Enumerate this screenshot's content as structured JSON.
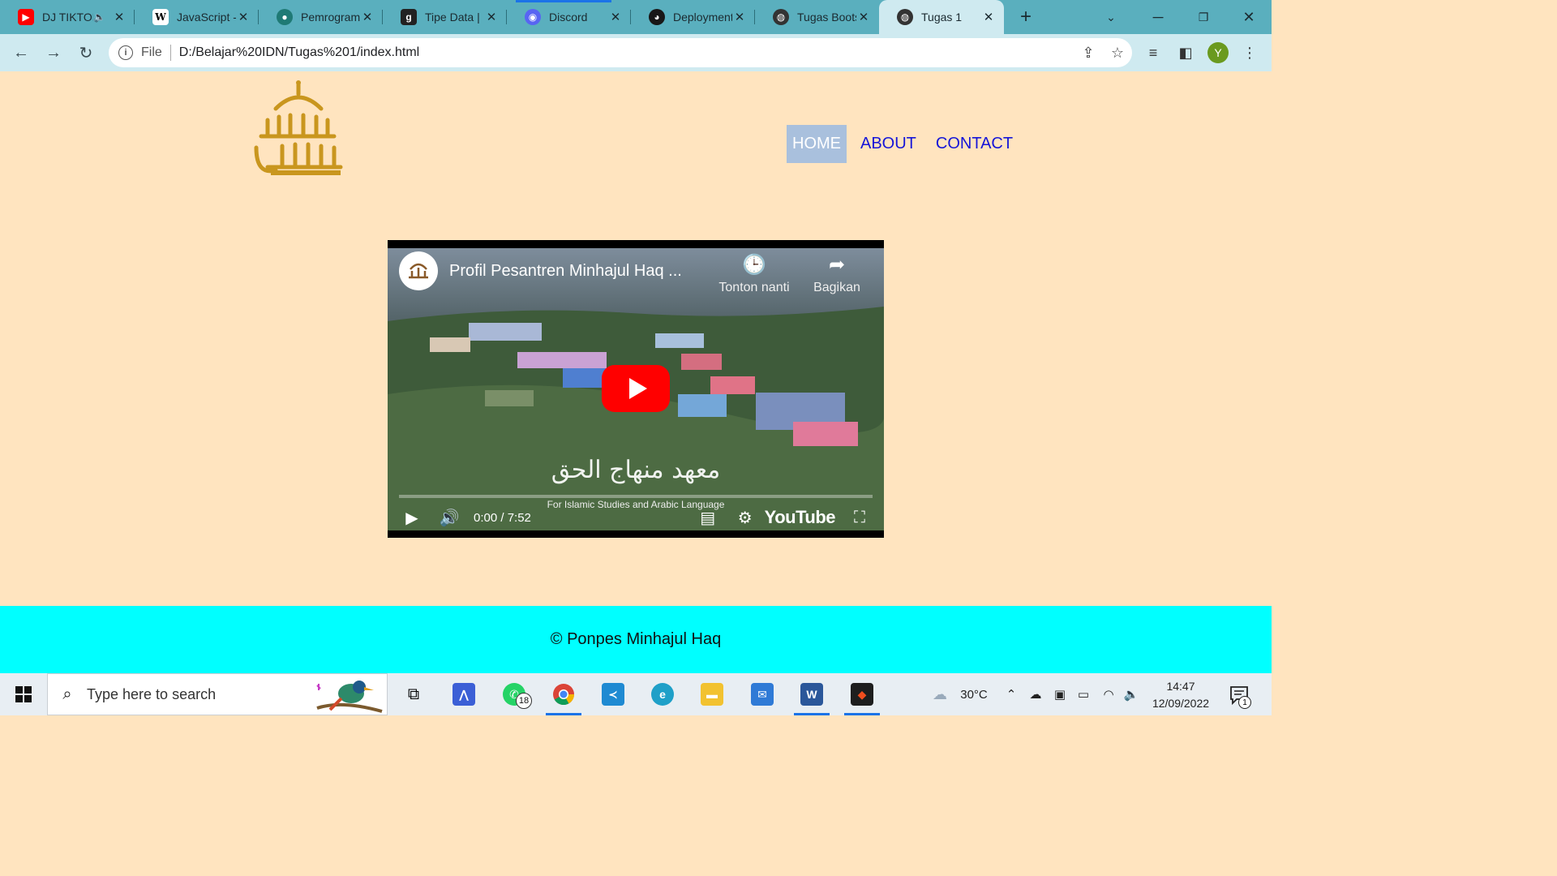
{
  "browser": {
    "tabs": [
      {
        "title": "DJ TIKTOK",
        "icon": "youtube-icon",
        "muted_icon": "speaker-icon",
        "color": "#ff0000"
      },
      {
        "title": "JavaScript - Wikipedia",
        "icon": "wikipedia-icon",
        "color": "#ffffff"
      },
      {
        "title": "Pemrograman",
        "icon": "site-icon",
        "color": "#1f7a75"
      },
      {
        "title": "Tipe Data | ",
        "icon": "site-icon",
        "color": "#222222"
      },
      {
        "title": "Discord",
        "icon": "discord-icon",
        "color": "#5865f2"
      },
      {
        "title": "Deployment",
        "icon": "github-icon",
        "color": "#181717"
      },
      {
        "title": "Tugas Bootstrap",
        "icon": "globe-icon",
        "color": "#333333"
      },
      {
        "title": "Tugas 1",
        "icon": "globe-icon",
        "color": "#333333",
        "active": true
      }
    ],
    "new_tab_label": "+",
    "address": {
      "scheme": "File",
      "url": "D:/Belajar%20IDN/Tugas%201/index.html"
    },
    "profile_initial": "Y"
  },
  "site": {
    "nav": [
      {
        "label": "HOME",
        "active": true
      },
      {
        "label": "ABOUT",
        "active": false
      },
      {
        "label": "CONTACT",
        "active": false
      }
    ],
    "video": {
      "title": "Profil Pesantren Minhajul Haq ...",
      "watch_later": "Tonton nanti",
      "share": "Bagikan",
      "arabic_caption": "معهد منهاج الحق",
      "english_caption": "For Islamic Studies and Arabic Language",
      "time": "0:00 / 7:52",
      "brand": "YouTube",
      "progress": 0.0
    },
    "footer": "© Ponpes Minhajul Haq",
    "colors": {
      "background": "#ffe4bf",
      "footer": "#00ffff",
      "nav_link": "#1515d8",
      "nav_active_bg": "#a9c0dd"
    }
  },
  "taskbar": {
    "search_placeholder": "Type here to search",
    "whatsapp_badge": "18",
    "weather": "30°C",
    "time": "14:47",
    "date": "12/09/2022",
    "notification_count": "1"
  }
}
